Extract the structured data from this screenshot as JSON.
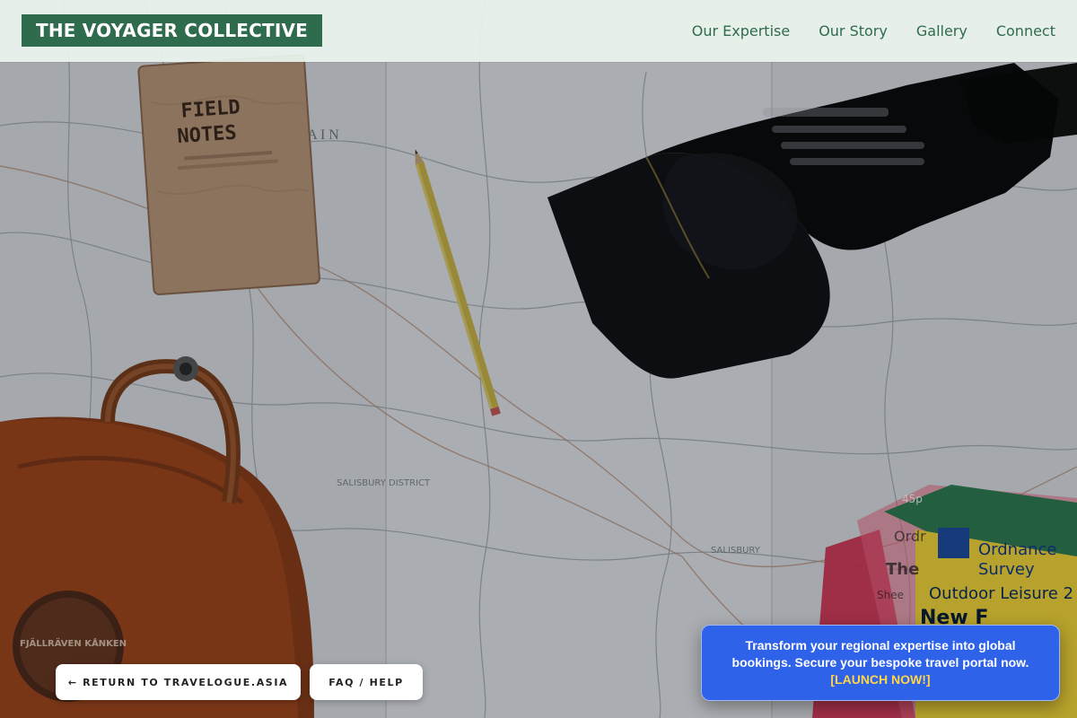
{
  "header": {
    "brand": "THE VOYAGER COLLECTIVE",
    "nav": [
      {
        "label": "Our Expertise"
      },
      {
        "label": "Our Story"
      },
      {
        "label": "Gallery"
      },
      {
        "label": "Connect"
      }
    ]
  },
  "hero": {
    "notebook_line1": "FIELD",
    "notebook_line2": "NOTES",
    "map_label_1": "SALISBURY DISTRICT",
    "map_label_2": "SALISBURY",
    "map_letters": "L    A    I    N",
    "backpack_patch_text": "FJÄLLRÄVEN KÅNKEN",
    "maps_tag": "45p",
    "maps_line1": "Ordnance",
    "maps_line2": "Survey",
    "maps_line3": "Outdoor Leisure 2",
    "maps_line4": "New F",
    "maps_side_1": "Ordr",
    "maps_side_2": "The",
    "maps_side_3": "Shee"
  },
  "buttons": {
    "return_label": "← RETURN TO TRAVELOGUE.ASIA",
    "faq_label": "FAQ / HELP"
  },
  "promo": {
    "line1": "Transform your regional expertise into global",
    "line2": "bookings. Secure your bespoke travel portal now.",
    "cta": "[LAUNCH NOW!]"
  },
  "colors": {
    "brand_green": "#2f6b4d",
    "promo_blue": "#2e62e8",
    "cta_yellow": "#ffd54a"
  }
}
